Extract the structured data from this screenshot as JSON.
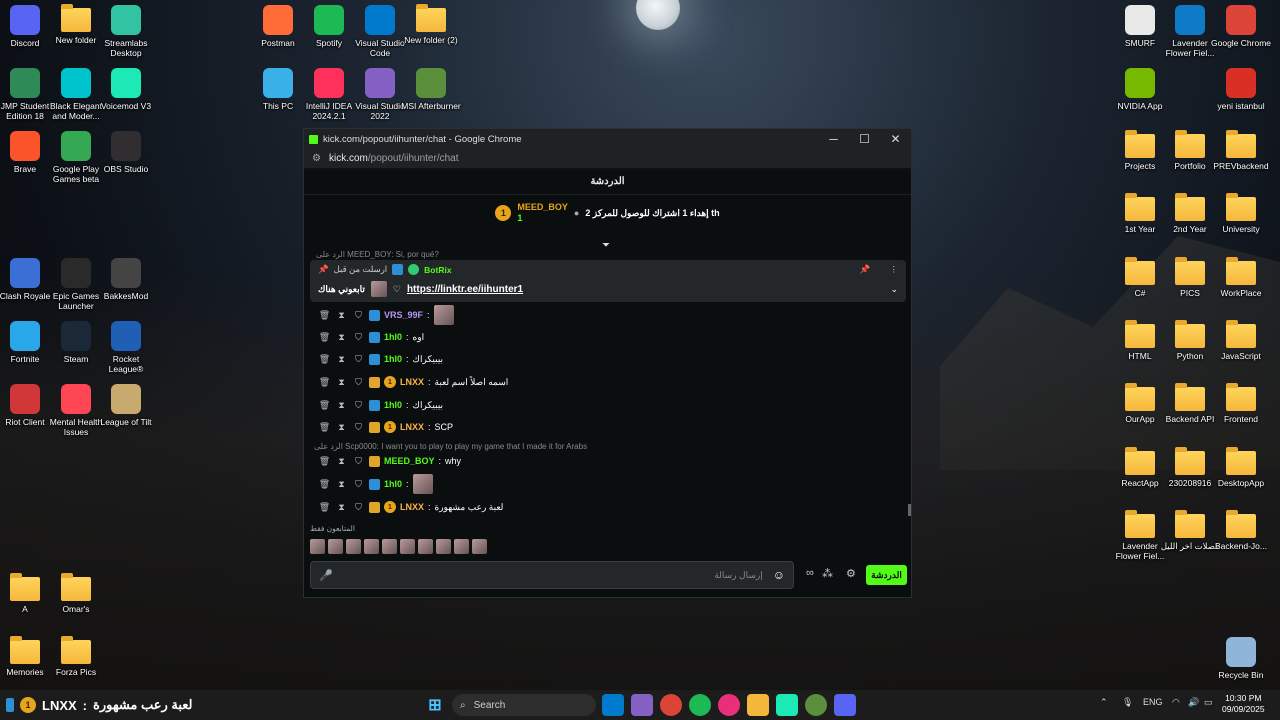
{
  "desktop": {
    "icons_left": [
      {
        "label": "Discord",
        "icon": "discord-icon",
        "color": "#5865F2"
      },
      {
        "label": "New folder",
        "icon": "folder-icon",
        "color": "#f5b73b"
      },
      {
        "label": "Streamlabs Desktop",
        "icon": "streamlabs-icon",
        "color": "#31C3A2"
      },
      {
        "label": "JMP Student Edition 18",
        "icon": "jmp-icon",
        "color": "#2e8b57"
      },
      {
        "label": "Black Elegant and Moder...",
        "icon": "canva-icon",
        "color": "#00C4CC"
      },
      {
        "label": "Voicemod V3",
        "icon": "voicemod-icon",
        "color": "#1de9b6"
      },
      {
        "label": "Brave",
        "icon": "brave-icon",
        "color": "#FB542B"
      },
      {
        "label": "Google Play Games beta",
        "icon": "play-games-icon",
        "color": "#34a853"
      },
      {
        "label": "OBS Studio",
        "icon": "obs-icon",
        "color": "#302e31"
      },
      {
        "label": "Clash Royale",
        "icon": "clash-royale-icon",
        "color": "#3b6fd6"
      },
      {
        "label": "Epic Games Launcher",
        "icon": "epic-icon",
        "color": "#2a2a2a"
      },
      {
        "label": "BakkesMod",
        "icon": "bakkesmod-icon",
        "color": "#444"
      },
      {
        "label": "Fortnite",
        "icon": "fortnite-icon",
        "color": "#2aa7e8"
      },
      {
        "label": "Steam",
        "icon": "steam-icon",
        "color": "#1b2838"
      },
      {
        "label": "Rocket League®",
        "icon": "rocket-league-icon",
        "color": "#1f5fb5"
      },
      {
        "label": "Riot Client",
        "icon": "riot-icon",
        "color": "#d13639"
      },
      {
        "label": "Mental Health Issues",
        "icon": "valorant-icon",
        "color": "#ff4655"
      },
      {
        "label": "League of Tilt",
        "icon": "league-icon",
        "color": "#c8aa6e"
      },
      {
        "label": "A",
        "icon": "folder-icon",
        "color": "#f5b73b"
      },
      {
        "label": "Omar's",
        "icon": "folder-icon",
        "color": "#f5b73b"
      },
      {
        "label": "Memories",
        "icon": "folder-icon",
        "color": "#f5b73b"
      },
      {
        "label": "Forza Pics",
        "icon": "folder-icon",
        "color": "#f5b73b"
      }
    ],
    "icons_mid": [
      {
        "label": "Postman",
        "icon": "postman-icon",
        "color": "#FF6C37"
      },
      {
        "label": "Spotify",
        "icon": "spotify-icon",
        "color": "#1DB954"
      },
      {
        "label": "Visual Studio Code",
        "icon": "vscode-icon",
        "color": "#007ACC"
      },
      {
        "label": "New folder (2)",
        "icon": "folder-icon",
        "color": "#f5b73b"
      },
      {
        "label": "This PC",
        "icon": "monitor-icon",
        "color": "#3ab0e8"
      },
      {
        "label": "IntelliJ IDEA 2024.2.1",
        "icon": "intellij-icon",
        "color": "#fe315d"
      },
      {
        "label": "Visual Studio 2022",
        "icon": "visual-studio-icon",
        "color": "#8661c5"
      },
      {
        "label": "MSI Afterburner",
        "icon": "afterburner-icon",
        "color": "#5a8f3c"
      }
    ],
    "icons_right": [
      {
        "label": "SMURF",
        "icon": "document-icon",
        "color": "#e8e8e8"
      },
      {
        "label": "Lavender Flower Fiel...",
        "icon": "edge-icon",
        "color": "#0f7ac8"
      },
      {
        "label": "Google Chrome",
        "icon": "chrome-icon",
        "color": "#db4437"
      },
      {
        "label": "NVIDIA App",
        "icon": "nvidia-icon",
        "color": "#76b900"
      },
      {
        "label": "yeni istanbul",
        "icon": "pdf-icon",
        "color": "#d93025"
      },
      {
        "label": "Projects",
        "icon": "folder-icon",
        "color": "#f5b73b"
      },
      {
        "label": "Portfolio",
        "icon": "folder-icon",
        "color": "#f5b73b"
      },
      {
        "label": "PREVbackend",
        "icon": "folder-icon",
        "color": "#f5b73b"
      },
      {
        "label": "1st Year",
        "icon": "folder-icon",
        "color": "#f5b73b"
      },
      {
        "label": "2nd Year",
        "icon": "folder-icon",
        "color": "#f5b73b"
      },
      {
        "label": "University",
        "icon": "folder-icon",
        "color": "#f5b73b"
      },
      {
        "label": "C#",
        "icon": "folder-icon",
        "color": "#f5b73b"
      },
      {
        "label": "PICS",
        "icon": "folder-icon",
        "color": "#f5b73b"
      },
      {
        "label": "WorkPlace",
        "icon": "folder-icon",
        "color": "#f5b73b"
      },
      {
        "label": "HTML",
        "icon": "folder-icon",
        "color": "#f5b73b"
      },
      {
        "label": "Python",
        "icon": "folder-icon",
        "color": "#f5b73b"
      },
      {
        "label": "JavaScript",
        "icon": "folder-icon",
        "color": "#f5b73b"
      },
      {
        "label": "OurApp",
        "icon": "folder-icon",
        "color": "#f5b73b"
      },
      {
        "label": "Backend API",
        "icon": "folder-icon",
        "color": "#f5b73b"
      },
      {
        "label": "Frontend",
        "icon": "folder-icon",
        "color": "#f5b73b"
      },
      {
        "label": "ReactApp",
        "icon": "folder-icon",
        "color": "#f5b73b"
      },
      {
        "label": "230208916",
        "icon": "folder-icon",
        "color": "#f5b73b"
      },
      {
        "label": "DesktopApp",
        "icon": "folder-icon",
        "color": "#f5b73b"
      },
      {
        "label": "Lavender Flower Fiel...",
        "icon": "folder-icon",
        "color": "#f5b73b"
      },
      {
        "label": "فصلات اخر الليل",
        "icon": "folder-icon",
        "color": "#f5b73b"
      },
      {
        "label": "Backend-Jo...",
        "icon": "folder-icon",
        "color": "#f5b73b"
      },
      {
        "label": "Recycle Bin",
        "icon": "recycle-bin-icon",
        "color": "#8fb6d8"
      }
    ]
  },
  "window": {
    "title": "kick.com/popout/iihunter/chat - Google Chrome",
    "url_host": "kick.com",
    "url_path": "/popout/iihunter/chat",
    "controls": {
      "minimize": "─",
      "maximize": "☐",
      "close": "✕"
    }
  },
  "chat": {
    "header": "الدردشة",
    "goal": {
      "user": "MEED_BOY",
      "count": "1",
      "coin": "1",
      "text": "إهداء 1 اشتراك للوصول للمركز 2 th"
    },
    "hidden_reply": "الرد على MEED_BOY: Si, por qué?",
    "pinned": {
      "pinned_by": "ارسلت من قبل",
      "user": "BotRix",
      "prefix_text": "تابعوني هناك",
      "link": "https://linktr.ee/iihunter1"
    },
    "messages": [
      {
        "user": "VRS_99F",
        "text": "",
        "color": "#b794f6"
      },
      {
        "user": "1hl0",
        "text": "اوه",
        "color": "#53fc18"
      },
      {
        "user": "1hl0",
        "text": "بيبيكراك",
        "color": "#53fc18"
      },
      {
        "user": "LNXX",
        "text": "اسمه اصلاً اسم لعبة",
        "color": "#ffb347"
      },
      {
        "user": "1hl0",
        "text": "بيبيكراك",
        "color": "#53fc18"
      },
      {
        "user": "LNXX",
        "text": "SCP",
        "color": "#ffb347"
      },
      {
        "user": "MEED_BOY",
        "text": "why",
        "color": "#53fc18"
      },
      {
        "user": "1hl0",
        "text": "",
        "color": "#53fc18"
      },
      {
        "user": "LNXX",
        "text": "لعبة رعب مشهورة",
        "color": "#ffb347"
      }
    ],
    "reply_line": "الرد على Scp0000: I want you to play to play my game that I made it for Arabs",
    "subs_only": "المتابعون فقط",
    "input_placeholder": "إرسال رسالة",
    "send_label": "الدردشة"
  },
  "taskbar": {
    "ticker_user": "LNXX",
    "ticker_text": "لعبة رعب مشهورة",
    "ticker_coin": "1",
    "search_label": "Search",
    "lang": "ENG",
    "time": "10:30 PM",
    "date": "09/09/2025"
  }
}
